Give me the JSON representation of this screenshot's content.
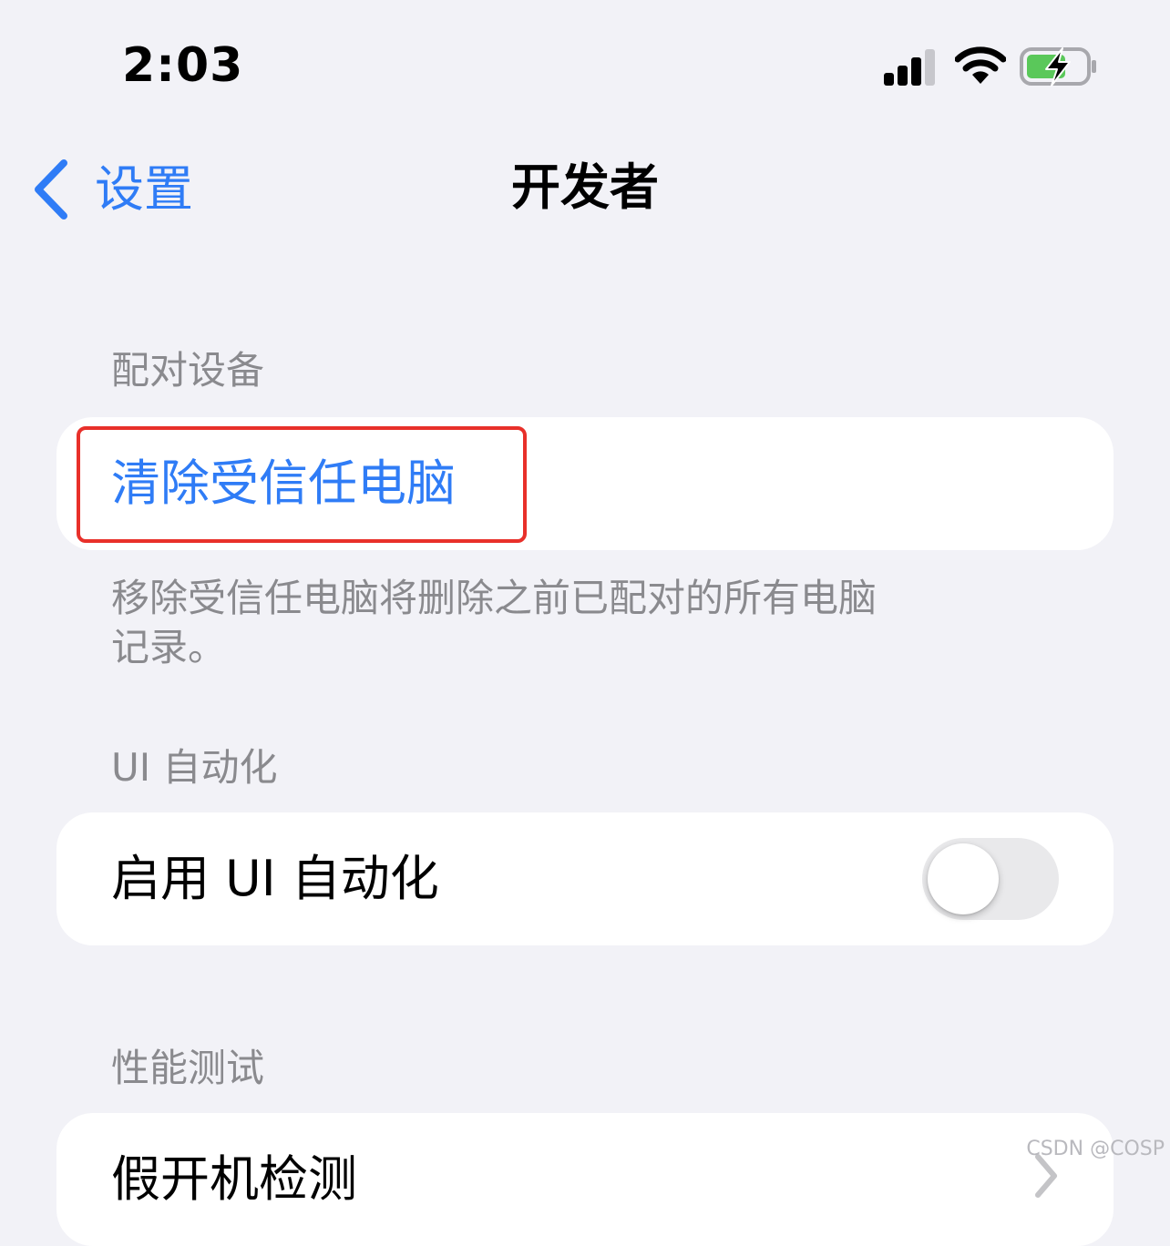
{
  "status_bar": {
    "time": "2:03",
    "icons": [
      "cellular-signal-icon",
      "wifi-icon",
      "battery-charging-icon"
    ],
    "battery_color": "#5ac85a"
  },
  "nav": {
    "back_label": "设置",
    "title": "开发者"
  },
  "sections": {
    "pairing": {
      "header": "配对设备",
      "row_label": "清除受信任电脑",
      "footer": "移除受信任电脑将删除之前已配对的所有电脑记录。"
    },
    "ui_automation": {
      "header": "UI 自动化",
      "row_label": "启用 UI 自动化",
      "toggle_on": false
    },
    "performance": {
      "header": "性能测试",
      "row_label": "假开机检测"
    }
  },
  "watermark": "CSDN @COSP",
  "colors": {
    "accent": "#2f7cf6",
    "background": "#f2f2f7",
    "highlight": "#e8302a"
  }
}
